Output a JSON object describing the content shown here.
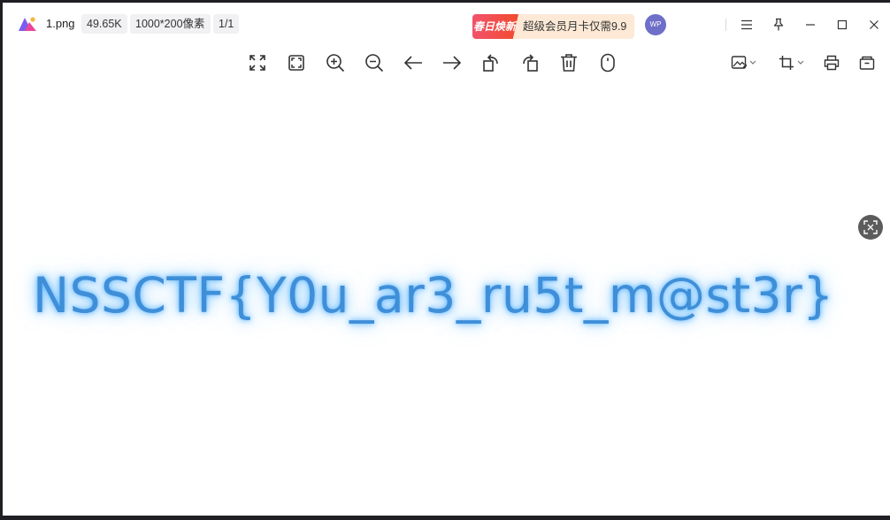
{
  "titlebar": {
    "file_name": "1.png",
    "file_size": "49.65K",
    "dimensions": "1000*200像素",
    "page_indicator": "1/1",
    "promo_tag": "春日焕新",
    "promo_text": "超级会员月卡仅需9.9",
    "avatar_initials": "WP"
  },
  "toolbar": {
    "tools": [
      "fullscreen-icon",
      "fit-window-icon",
      "zoom-in-icon",
      "zoom-out-icon",
      "previous-arrow-icon",
      "next-arrow-icon",
      "rotate-left-icon",
      "rotate-right-icon",
      "delete-icon",
      "mouse-icon"
    ],
    "right_tools": [
      "image-edit-icon",
      "crop-icon",
      "print-icon",
      "open-folder-icon"
    ]
  },
  "canvas": {
    "flag_text": "NSSCTF{Y0u_ar3_ru5t_m@st3r}"
  },
  "colors": {
    "accent_text": "#3f8ed8",
    "glow": "#5ab9ff",
    "promo_bg": "#fde9d6",
    "promo_tag": "#f24a4e",
    "avatar": "#6d6fc8"
  }
}
